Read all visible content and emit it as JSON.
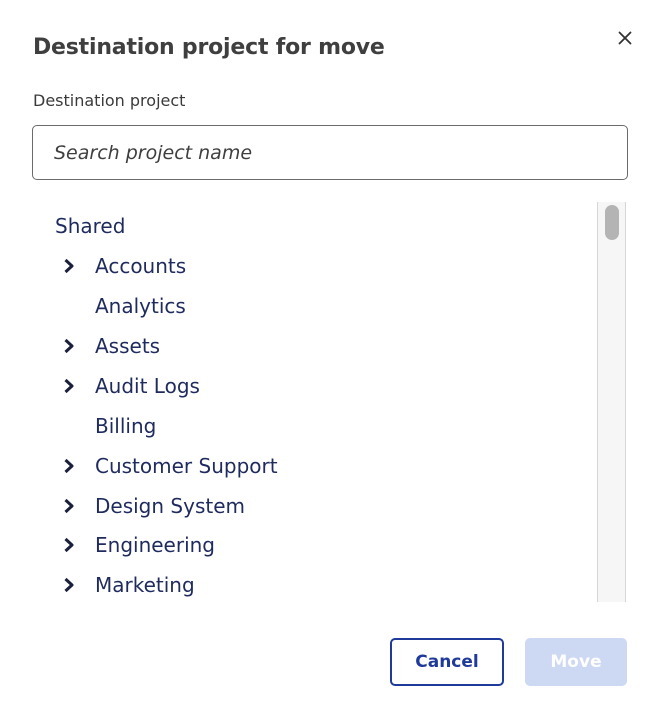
{
  "dialog": {
    "title": "Destination project for move",
    "close_icon": "close-icon",
    "field_label": "Destination project"
  },
  "search": {
    "placeholder": "Search project name",
    "value": ""
  },
  "tree": {
    "root_label": "Shared",
    "items": [
      {
        "label": "Accounts",
        "expandable": true
      },
      {
        "label": "Analytics",
        "expandable": false
      },
      {
        "label": "Assets",
        "expandable": true
      },
      {
        "label": "Audit Logs",
        "expandable": true
      },
      {
        "label": "Billing",
        "expandable": false
      },
      {
        "label": "Customer Support",
        "expandable": true
      },
      {
        "label": "Design System",
        "expandable": true
      },
      {
        "label": "Engineering",
        "expandable": true
      },
      {
        "label": "Marketing",
        "expandable": true
      }
    ],
    "chevron_icon": "chevron-right-icon"
  },
  "footer": {
    "cancel_label": "Cancel",
    "move_label": "Move",
    "move_disabled": true
  },
  "colors": {
    "accent": "#1f3a9b",
    "tree_text": "#1f2b5e",
    "disabled_button": "#cdd8f2"
  }
}
